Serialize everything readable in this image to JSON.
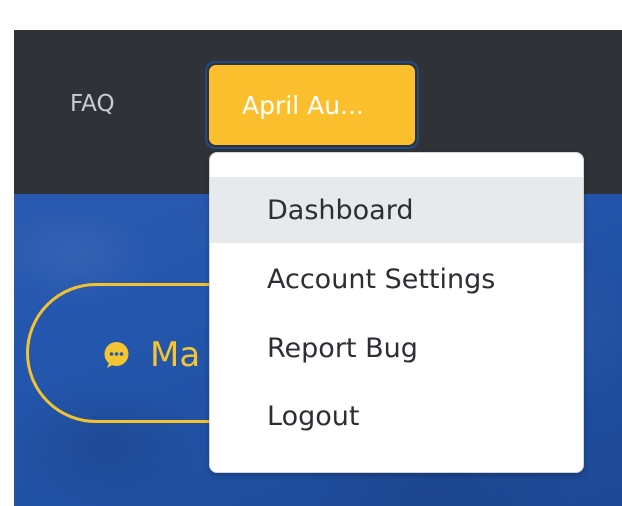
{
  "navbar": {
    "faq_label": "FAQ",
    "user_menu_label": "April Au..."
  },
  "dropdown": {
    "items": [
      {
        "label": "Dashboard",
        "active": true
      },
      {
        "label": "Account Settings",
        "active": false
      },
      {
        "label": "Report Bug",
        "active": false
      },
      {
        "label": "Logout",
        "active": false
      }
    ]
  },
  "hero": {
    "button_label": "Ma",
    "button_icon": "chat-bubble-icon"
  },
  "colors": {
    "navbar_bg": "#2f3338",
    "accent_yellow": "#fbbf2d",
    "hero_blue": "#2456ad",
    "menu_active_bg": "#e6eaec"
  }
}
